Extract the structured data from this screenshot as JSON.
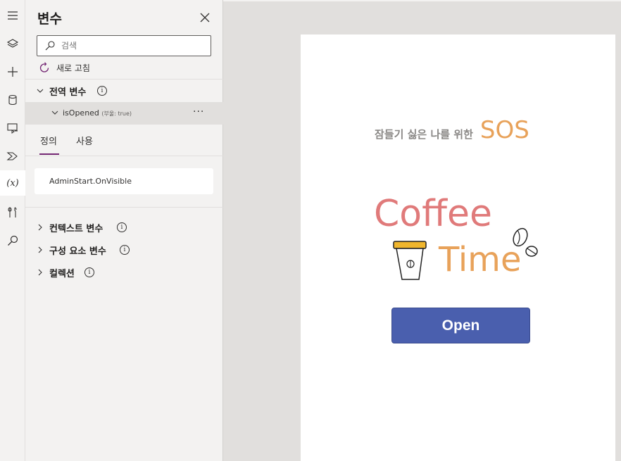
{
  "rail": {
    "items": [
      "hamburger-icon",
      "layers-icon",
      "plus-icon",
      "database-icon",
      "media-icon",
      "power-automate-icon",
      "variables-icon",
      "tools-icon",
      "search-icon"
    ],
    "variables_label": "(x)"
  },
  "panel": {
    "title": "변수",
    "search": {
      "placeholder": "검색",
      "value": ""
    },
    "refresh_label": "새로 고침",
    "global_section": {
      "label": "전역 변수",
      "variable": {
        "name": "isOpened",
        "type": "(부울: true)"
      }
    },
    "tabs": [
      {
        "label": "정의",
        "active": true
      },
      {
        "label": "사용",
        "active": false
      }
    ],
    "definition": "AdminStart.OnVisible",
    "sections": [
      {
        "label": "컨텍스트 변수"
      },
      {
        "label": "구성 요소 변수"
      },
      {
        "label": "컬렉션"
      }
    ],
    "info_glyph": "i"
  },
  "screen": {
    "tagline": "잠들기 싫은 나를 위한",
    "tagline_accent": "SOS",
    "logo_line1": "Coffee",
    "logo_line2": "Time",
    "open_button": "Open"
  },
  "colors": {
    "accent_underline": "#742774",
    "button": "#4a5fae",
    "coffee_text": "#e07a7a",
    "time_text": "#e8a25a"
  }
}
